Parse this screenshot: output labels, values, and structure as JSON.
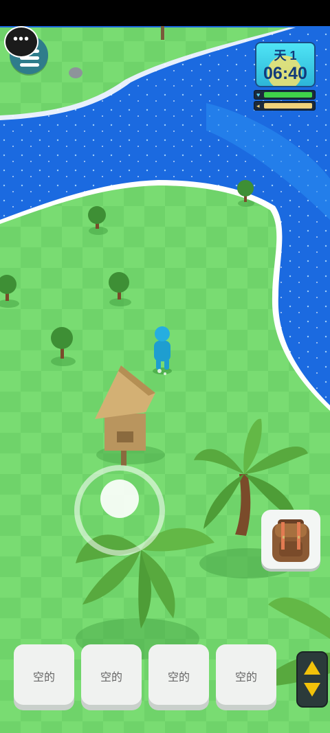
{
  "hud": {
    "day_label": "天 1",
    "time": "06:40"
  },
  "stats": {
    "health": {
      "icon": "heart-icon",
      "level": 1.0,
      "color": "#3fd24a"
    },
    "hunger": {
      "icon": "fish-icon",
      "level": 1.0,
      "color": "#f0d27a"
    }
  },
  "inventory": {
    "slots": [
      "空的",
      "空的",
      "空的",
      "空的"
    ]
  },
  "controls": {
    "backpack_icon": "backpack-icon",
    "scroll_up_icon": "triangle-up-icon",
    "scroll_down_icon": "triangle-down-icon",
    "menu_icon": "hamburger-menu-icon",
    "chat_icon": "chat-bubble-icon"
  },
  "colors": {
    "water": "#1e6fe0",
    "grass": "#6fd36a",
    "accent_yellow": "#f2c20a"
  }
}
